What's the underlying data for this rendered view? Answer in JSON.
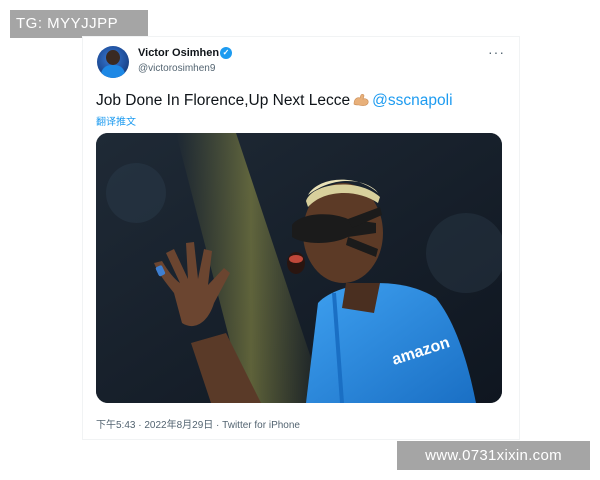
{
  "watermarks": {
    "top_left": "TG: MYYJJPP",
    "bottom_right": "www.0731xixin.com"
  },
  "tweet": {
    "author": {
      "name": "Victor Osimhen",
      "handle": "@victorosimhen9",
      "verified": true
    },
    "more_icon": "more-horizontal-icon",
    "text": "Job Done In Florence,Up Next Lecce",
    "emoji": "flexed-biceps",
    "mention": "@sscnapoli",
    "translate_label": "翻译推文",
    "photo_sponsor_text": "amazon",
    "timestamp": "下午5:43 · 2022年8月29日",
    "separator": " · ",
    "source": "Twitter for iPhone"
  },
  "colors": {
    "accent": "#1d9bf0",
    "text": "#0f1419",
    "secondary": "#536471"
  }
}
